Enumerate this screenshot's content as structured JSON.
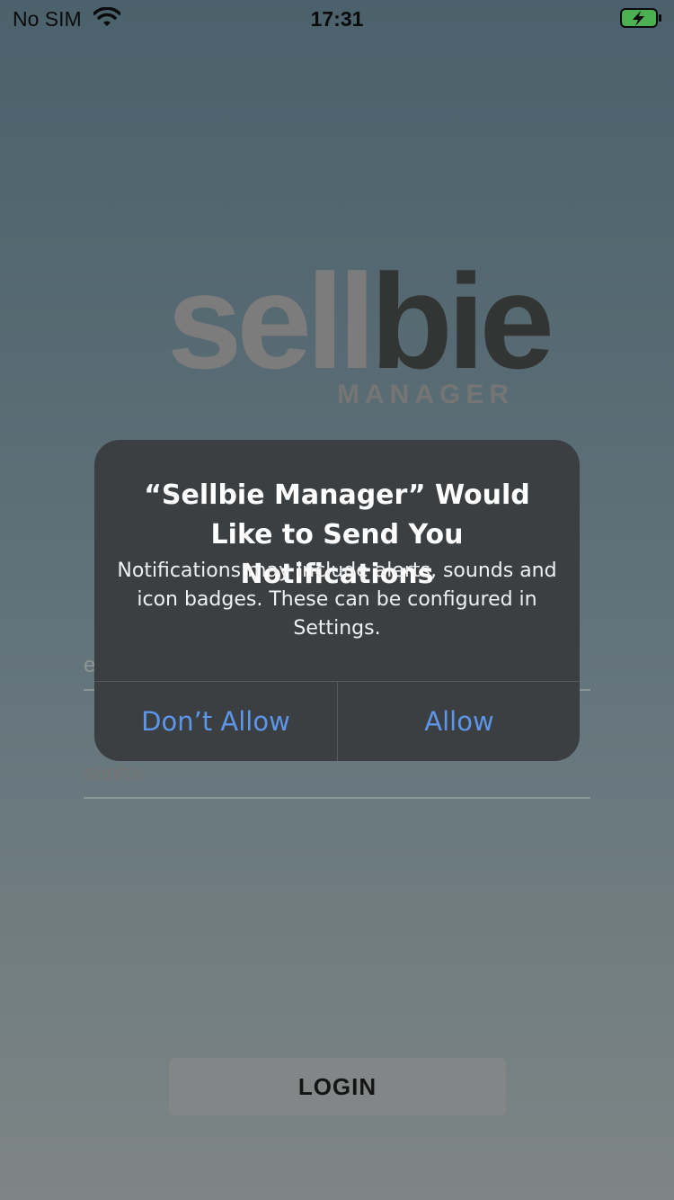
{
  "status_bar": {
    "carrier": "No SIM",
    "time": "17:31",
    "wifi_icon": "wifi-icon",
    "battery_icon": "battery-charging-icon"
  },
  "logo": {
    "word_part1": "sell",
    "word_part2": "bie",
    "subtitle": "MANAGER"
  },
  "form": {
    "email_value": "e",
    "password_placeholder": "senha",
    "login_label": "LOGIN"
  },
  "alert": {
    "title": "“Sellbie Manager” Would Like to Send You Notifications",
    "message": "Notifications may include alerts, sounds and icon badges. These can be configured in Settings.",
    "deny_label": "Don’t Allow",
    "allow_label": "Allow"
  },
  "colors": {
    "alert_bg": "#3b3f42",
    "alert_button_text": "#5d95ea",
    "logo_light": "#7c7c7c",
    "logo_dark": "#333535"
  }
}
